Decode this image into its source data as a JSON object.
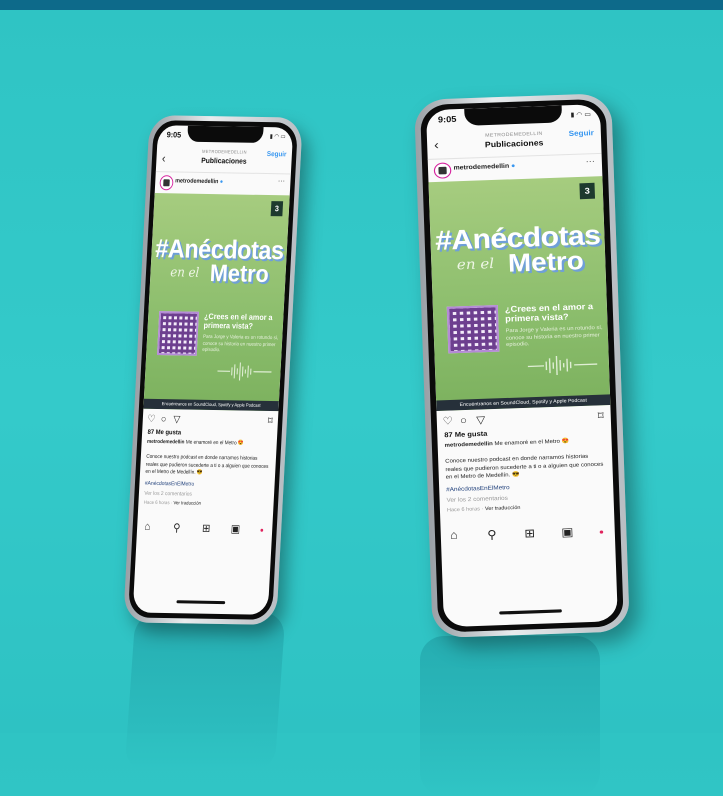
{
  "accent": "#3897f0",
  "phones": [
    {
      "time": "9:05",
      "status_icons": "signal-wifi-battery",
      "header_account": "METRODEMEDELLIN",
      "header_title": "Publicaciones",
      "follow_label": "Seguir",
      "username": "metrodemedellin",
      "post": {
        "brand_mark": "3",
        "headline": "#Anécdotas",
        "script_text": "en el",
        "metro_text": "Metro",
        "question": "¿Crees en el amor a primera vista?",
        "description": "Para Jorge y Valeria es un rotundo sí, conoce su historia en nuestro primer episodio.",
        "footer": "Encuéntranos en SoundCloud, Spotify y Apple Podcast"
      },
      "likes": "87 Me gusta",
      "caption_user": "metrodemedellin",
      "caption_text": "Me enamoré en el Metro 😍",
      "caption_body": "Conoce nuestro podcast en donde narramos historias reales que pudieron sucederte a ti o a alguien que conoces en el Metro de Medellín. 😎",
      "hashtag": "#AnécdotasEnElMetro",
      "comments": "Ver los 2 comentarios",
      "time_ago": "Hace 6 horas",
      "translate": "Ver traducción"
    },
    {
      "time": "9:05",
      "status_icons": "signal-wifi-battery",
      "header_account": "METRODEMEDELLIN",
      "header_title": "Publicaciones",
      "follow_label": "Seguir",
      "username": "metrodemedellin",
      "post": {
        "brand_mark": "3",
        "headline": "#Anécdotas",
        "script_text": "en el",
        "metro_text": "Metro",
        "question": "¿Crees en el amor a primera vista?",
        "description": "Para Jorge y Valeria es un rotundo sí, conoce su historia en nuestro primer episodio.",
        "footer": "Encuéntranos en SoundCloud, Spotify y Apple Podcast"
      },
      "likes": "87 Me gusta",
      "caption_user": "metrodemedellin",
      "caption_text": "Me enamoré en el Metro 😍",
      "caption_body": "Conoce nuestro podcast en donde narramos historias reales que pudieron sucederte a ti o a alguien que conoces en el Metro de Medellín. 😎",
      "hashtag": "#AnécdotasEnElMetro",
      "comments": "Ver los 2 comentarios",
      "time_ago": "Hace 6 horas",
      "translate": "Ver traducción"
    }
  ]
}
